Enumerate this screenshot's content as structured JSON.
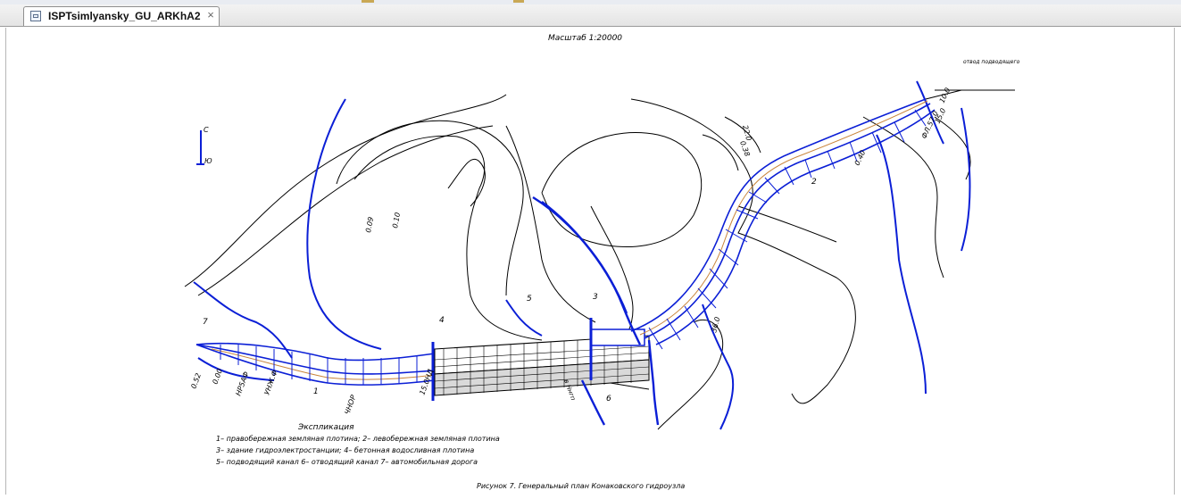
{
  "tab": {
    "title": "ISPTsimlyansky_GU_ARKhA2",
    "close_glyph": "×",
    "icon": "document-icon"
  },
  "drawing": {
    "scale": "Масштаб 1:20000",
    "compass": {
      "north": "С",
      "south": "Ю"
    },
    "outflow_label": "отвод подводящего",
    "legend": {
      "title": "Экспликация",
      "lines": [
        "1– правобережная земляная плотина; 2– левобережная земляная плотина",
        "3– здание гидроэлектростанции; 4– бетонная водосливная плотина",
        "5– подводящий канал    6– отводящий канал 7– автомобильная дорога"
      ]
    },
    "caption": "Рисунок 7. Генеральный план Конаковского гидроузла",
    "contour_labels": [
      "0.09",
      "0.10",
      "22.0",
      "0.38",
      "0.40",
      "36.0",
      "10.0",
      "ФЛ.57.0",
      "15.0",
      "0.52",
      "0.00",
      "НР5АФ",
      "УНЖ.Ф",
      "15.0НД",
      "ЧНОР"
    ],
    "markers": [
      "1",
      "2",
      "3",
      "4",
      "5",
      "6",
      "7",
      "в Ннгп"
    ]
  },
  "colors": {
    "accent_blue": "#0b1fd6",
    "ink": "#000000"
  }
}
